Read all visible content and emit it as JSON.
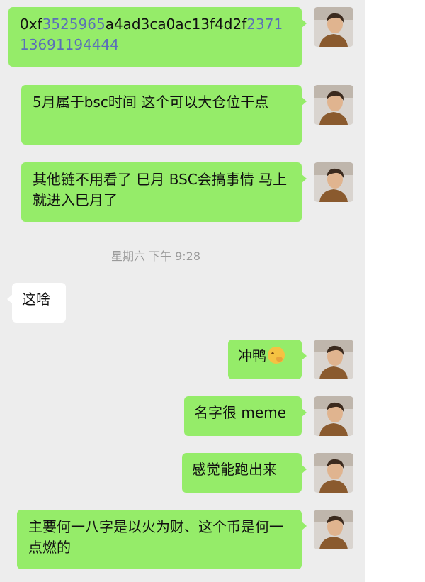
{
  "messages": [
    {
      "part1": "0xf",
      "part2": "3525965",
      "part3": "a4ad3ca0ac13f4d2f",
      "part4": "237",
      "part5": "113691194444"
    },
    {
      "text": "5月属于bsc时间 这个可以大仓位干点"
    },
    {
      "text": "其他链不用看了 巳月 BSC会搞事情 马上就进入巳月了"
    },
    {
      "text": "这啥"
    },
    {
      "text": "冲鸭",
      "emoji": "thinking-face-icon"
    },
    {
      "text": "名字很 meme"
    },
    {
      "text": "感觉能跑出来"
    },
    {
      "text": "主要何一八字是以火为财、这个币是何一点燃的"
    }
  ],
  "timestamp": "星期六 下午 9:28",
  "colors": {
    "outgoing_bubble": "#95ec69",
    "incoming_bubble": "#ffffff",
    "chat_bg": "#ededed",
    "link": "#5b6fb8"
  }
}
